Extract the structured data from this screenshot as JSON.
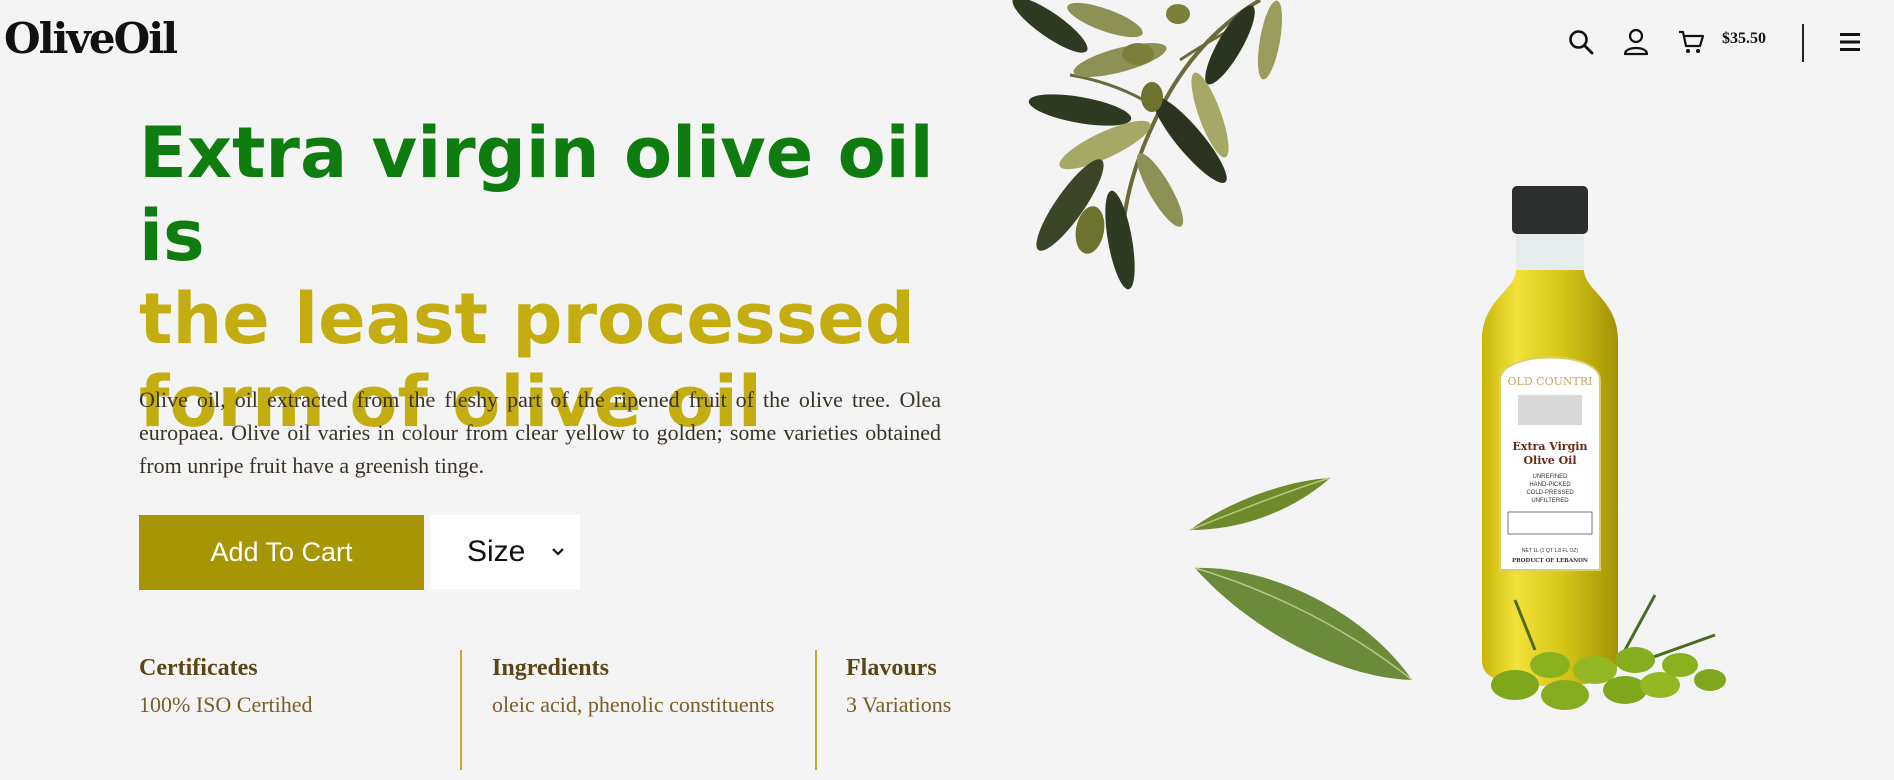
{
  "brand": {
    "logo": "OliveOil"
  },
  "nav": {
    "search_icon": "search-icon",
    "user_icon": "user-icon",
    "cart_icon": "cart-icon",
    "cart_total": "$35.50",
    "menu_icon": "hamburger-menu-icon"
  },
  "hero": {
    "title_line1": "Extra virgin olive oil is",
    "title_line2": "the least processed",
    "title_line3": "form of olive oil",
    "description": "Olive oil, oil extracted from the fleshy part of the ripened fruit of the olive tree. Olea europaea. Olive oil varies in colour from clear yellow to golden; some varieties obtained from unripe fruit have a greenish tinge."
  },
  "actions": {
    "add_to_cart_label": "Add To Cart",
    "size_label": "Size"
  },
  "features": [
    {
      "title": "Certificates",
      "value": "100% ISO Certihed"
    },
    {
      "title": "Ingredients",
      "value": "oleic acid, phenolic constituents"
    },
    {
      "title": "Flavours",
      "value": "3 Variations"
    }
  ],
  "product_label": {
    "brand": "OLD COUNTRI",
    "name_line1": "Extra Virgin",
    "name_line2": "Olive Oil",
    "attr1": "UNREFINED",
    "attr2": "HAND-PICKED",
    "attr3": "COLD-PRESSED",
    "attr4": "UNFILTERED",
    "net": "NET 1L (1 QT 1.8 FL OZ)",
    "origin": "PRODUCT OF LEBANON"
  },
  "colors": {
    "title_green": "#0f7c0f",
    "title_gold": "#c3ad10",
    "button_bg": "#a89505",
    "feature_title": "#5a4517",
    "feature_value": "#7a5d27",
    "divider": "#c5a838",
    "background": "#f4f4f4"
  }
}
